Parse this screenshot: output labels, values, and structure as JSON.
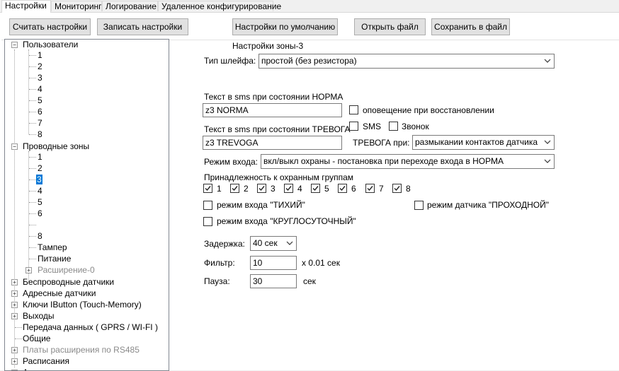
{
  "tabs": [
    "Настройки",
    "Мониторинг",
    "Логирование",
    "Удаленное конфигурирование"
  ],
  "toolbar": {
    "read": "Считать настройки",
    "write": "Записать настройки",
    "defaults": "Настройки по умолчанию",
    "open": "Открыть файл",
    "save": "Сохранить в файл"
  },
  "tree": {
    "users": "Пользователи",
    "user_items": [
      "1",
      "2",
      "3",
      "4",
      "5",
      "6",
      "7",
      "8"
    ],
    "zones": "Проводные зоны",
    "zone_items": [
      "1",
      "2",
      "3",
      "4",
      "5",
      "6",
      "",
      "8"
    ],
    "tamper": "Тампер",
    "power": "Питание",
    "expansion": "Расширение-0",
    "wireless": "Беспроводные датчики",
    "address": "Адресные датчики",
    "ibutton": "Ключи IButton (Touch-Memory)",
    "outputs": "Выходы",
    "transfer": "Передача данных ( GPRS / WI-FI )",
    "general": "Общие",
    "rs485": "Платы расширения по RS485",
    "schedules": "Расписания",
    "cut": "А"
  },
  "form": {
    "title": "Настройки зоны-3",
    "loop_type_label": "Тип шлейфа:",
    "loop_type_value": "простой (без резистора)",
    "norma_label": "Текст в sms при состоянии НОРМА",
    "norma_value": "z3 NORMA",
    "restore_label": "оповещение при восстановлении",
    "alarm_label": "Текст в sms при состоянии ТРЕВОГА",
    "alarm_value": "z3 TREVOGA",
    "sms_label": "SMS",
    "call_label": "Звонок",
    "alarm_on_label": "ТРЕВОГА при:",
    "alarm_on_value": "размыкании контактов датчика",
    "entry_mode_label": "Режим входа:",
    "entry_mode_value": "вкл/выкл охраны - постановка при переходе входа в НОРМА",
    "groups_label": "Принадлежность к охранным группам",
    "groups": [
      "1",
      "2",
      "3",
      "4",
      "5",
      "6",
      "7",
      "8"
    ],
    "quiet_label": "режим входа \"ТИХИЙ\"",
    "passage_label": "режим датчика \"ПРОХОДНОЙ\"",
    "roundclock_label": "режим входа \"КРУГЛОСУТОЧНЫЙ\"",
    "delay_label": "Задержка:",
    "delay_value": "40 сек",
    "filter_label": "Фильтр:",
    "filter_value": "10",
    "filter_unit": "x 0.01 сек",
    "pause_label": "Пауза:",
    "pause_value": "30",
    "pause_unit": "сек"
  }
}
